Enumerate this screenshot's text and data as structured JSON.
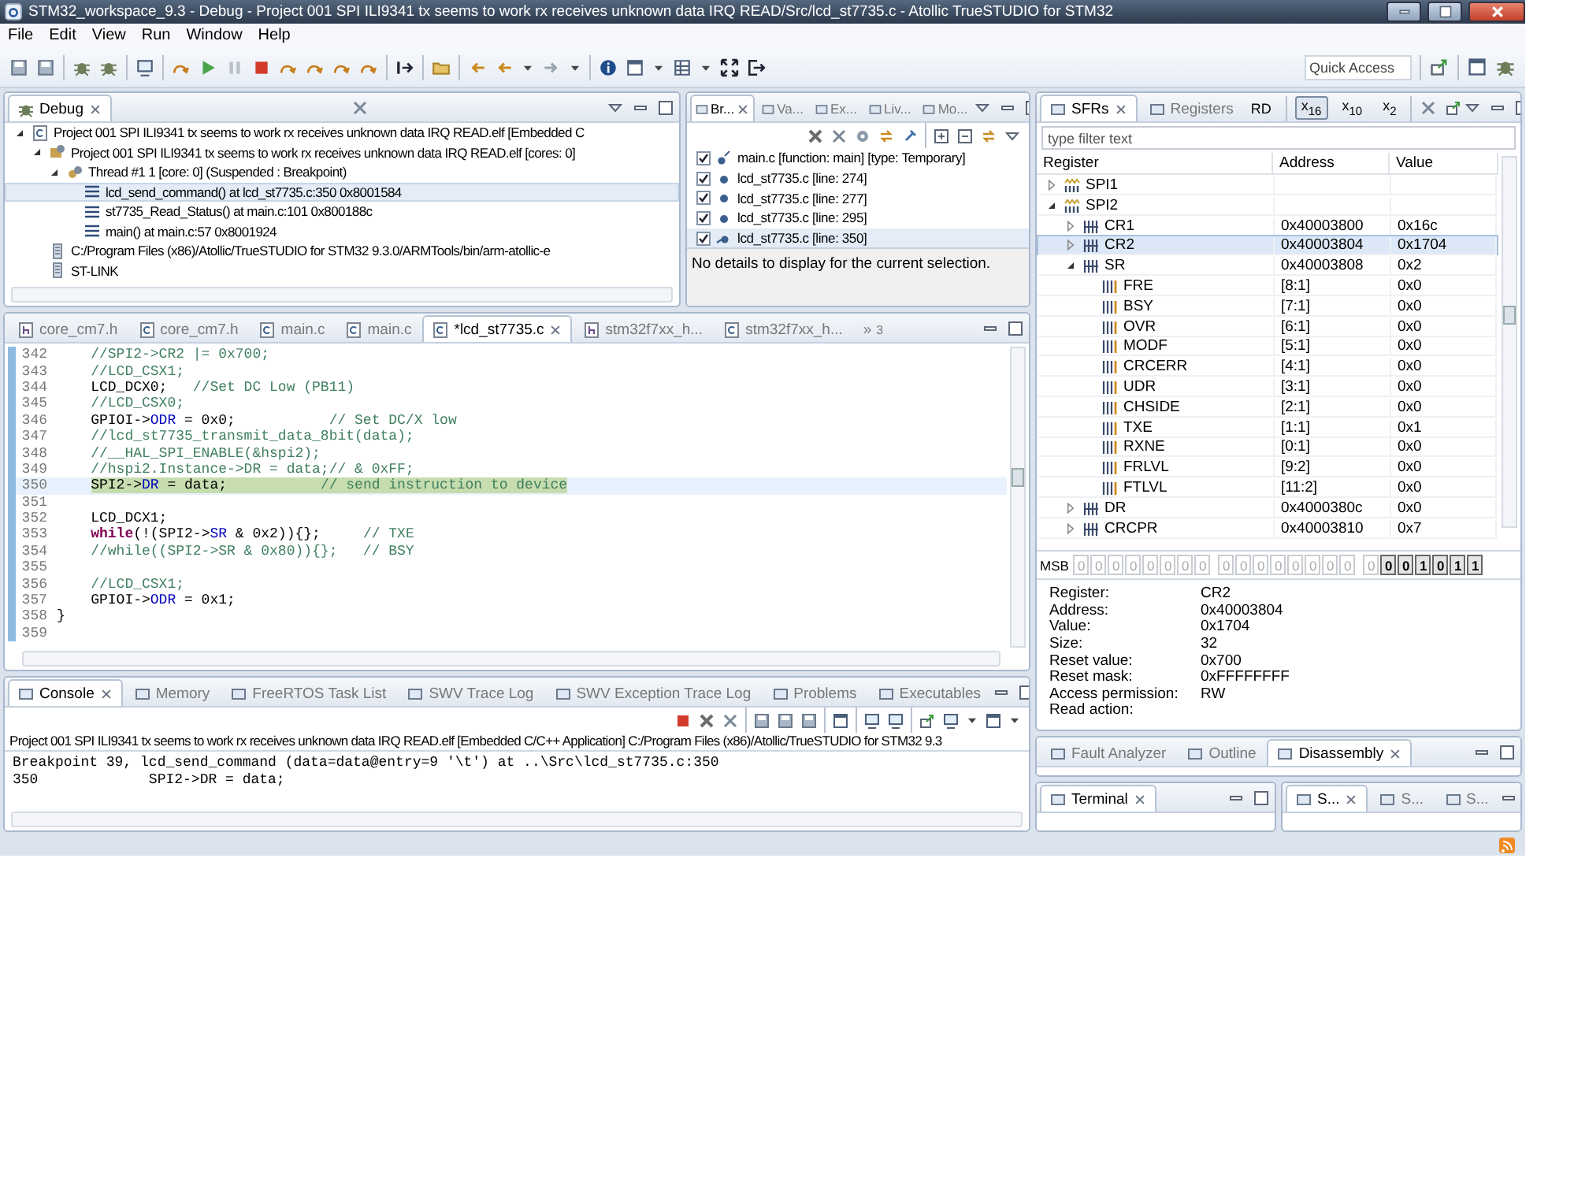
{
  "window": {
    "title": "STM32_workspace_9.3 - Debug - Project 001 SPI ILI9341 tx seems to work rx receives unknown data IRQ READ/Src/lcd_st7735.c - Atollic TrueSTUDIO for STM32"
  },
  "menu": [
    "File",
    "Edit",
    "View",
    "Run",
    "Window",
    "Help"
  ],
  "quick_access": {
    "placeholder": "Quick Access"
  },
  "debug_view": {
    "tab": "Debug",
    "tree": [
      {
        "kind": "launch",
        "label": "Project 001 SPI ILI9341 tx seems to work rx receives unknown data IRQ READ.elf [Embedded C",
        "expanded": true,
        "selected": false,
        "children": [
          {
            "kind": "process",
            "label": "Project 001 SPI ILI9341 tx seems to work rx receives unknown data IRQ READ.elf [cores: 0]",
            "expanded": true,
            "selected": false,
            "children": [
              {
                "kind": "thread",
                "label": "Thread #1 1 [core: 0] (Suspended : Breakpoint)",
                "expanded": true,
                "selected": false,
                "children": [
                  {
                    "kind": "frame",
                    "label": "lcd_send_command() at lcd_st7735.c:350 0x8001584",
                    "selected": true
                  },
                  {
                    "kind": "frame",
                    "label": "st7735_Read_Status() at main.c:101 0x800188c",
                    "selected": false
                  },
                  {
                    "kind": "frame",
                    "label": "main() at main.c:57 0x8001924",
                    "selected": false
                  }
                ]
              }
            ]
          },
          {
            "kind": "binary",
            "label": "C:/Program Files (x86)/Atollic/TrueSTUDIO for STM32 9.3.0/ARMTools/bin/arm-atollic-e",
            "selected": false
          },
          {
            "kind": "binary",
            "label": "ST-LINK",
            "selected": false
          }
        ]
      }
    ]
  },
  "breakpoints_view": {
    "tabs": [
      {
        "label": "Br...",
        "selected": true
      },
      {
        "label": "Va...",
        "selected": false
      },
      {
        "label": "Ex...",
        "selected": false
      },
      {
        "label": "Liv...",
        "selected": false
      },
      {
        "label": "Mo...",
        "selected": false
      }
    ],
    "items": [
      {
        "kind": "temporary",
        "label": "main.c [function: main] [type: Temporary]",
        "checked": true,
        "selected": false
      },
      {
        "kind": "line",
        "label": "lcd_st7735.c [line: 274]",
        "checked": true,
        "selected": false
      },
      {
        "kind": "line",
        "label": "lcd_st7735.c [line: 277]",
        "checked": true,
        "selected": false
      },
      {
        "kind": "line",
        "label": "lcd_st7735.c [line: 295]",
        "checked": true,
        "selected": false
      },
      {
        "kind": "current",
        "label": "lcd_st7735.c [line: 350]",
        "checked": true,
        "selected": true
      }
    ],
    "details": "No details to display for the current selection."
  },
  "editor": {
    "tabs": [
      {
        "kind": "h",
        "label": "core_cm7.h",
        "selected": false
      },
      {
        "kind": "c",
        "label": "core_cm7.h",
        "selected": false
      },
      {
        "kind": "c",
        "label": "main.c",
        "selected": false
      },
      {
        "kind": "c",
        "label": "main.c",
        "selected": false
      },
      {
        "kind": "c",
        "label": "*lcd_st7735.c",
        "selected": true
      },
      {
        "kind": "h",
        "label": "stm32f7xx_h...",
        "selected": false
      },
      {
        "kind": "c",
        "label": "stm32f7xx_h...",
        "selected": false
      }
    ],
    "overflow": "»",
    "overflow_count": "3",
    "lines": [
      {
        "number": "342",
        "current": false,
        "indented": true,
        "segments": [
          {
            "kind": "comment",
            "text": "//SPI2->CR2 |= 0x700;"
          }
        ]
      },
      {
        "number": "343",
        "current": false,
        "indented": true,
        "segments": [
          {
            "kind": "comment",
            "text": "//LCD_CSX1;"
          }
        ]
      },
      {
        "number": "344",
        "current": false,
        "indented": true,
        "segments": [
          {
            "kind": "code",
            "text": "LCD_DCX0;   "
          },
          {
            "kind": "comment",
            "text": "//Set DC Low (PB11)"
          }
        ]
      },
      {
        "number": "345",
        "current": false,
        "indented": true,
        "segments": [
          {
            "kind": "comment",
            "text": "//LCD_CSX0;"
          }
        ]
      },
      {
        "number": "346",
        "current": false,
        "indented": true,
        "segments": [
          {
            "kind": "code",
            "text": "GPIOI->"
          },
          {
            "kind": "field",
            "text": "ODR"
          },
          {
            "kind": "code",
            "text": " = 0x0;           "
          },
          {
            "kind": "comment",
            "text": "// Set DC/X low"
          }
        ]
      },
      {
        "number": "347",
        "current": false,
        "indented": true,
        "segments": [
          {
            "kind": "comment",
            "text": "//lcd_st7735_transmit_data_8bit(data);"
          }
        ]
      },
      {
        "number": "348",
        "current": false,
        "indented": true,
        "segments": [
          {
            "kind": "comment",
            "text": "//__HAL_SPI_ENABLE(&hspi2);"
          }
        ]
      },
      {
        "number": "349",
        "current": false,
        "indented": true,
        "segments": [
          {
            "kind": "comment",
            "text": "//hspi2.Instance->DR = data;// & 0xFF;"
          }
        ]
      },
      {
        "number": "350",
        "current": true,
        "indented": true,
        "segments": [
          {
            "kind": "code",
            "text": "SPI2->"
          },
          {
            "kind": "field",
            "text": "DR"
          },
          {
            "kind": "code",
            "text": " = data;           "
          },
          {
            "kind": "comment",
            "text": "// send instruction to device"
          }
        ]
      },
      {
        "number": "351",
        "current": false
      },
      {
        "number": "352",
        "current": false,
        "indented": true,
        "segments": [
          {
            "kind": "code",
            "text": "LCD_DCX1;"
          }
        ]
      },
      {
        "number": "353",
        "current": false,
        "indented": true,
        "segments": [
          {
            "kind": "keyword",
            "text": "while"
          },
          {
            "kind": "code",
            "text": "(!(SPI2->"
          },
          {
            "kind": "field",
            "text": "SR"
          },
          {
            "kind": "code",
            "text": " & 0x2)){};     "
          },
          {
            "kind": "comment",
            "text": "// TXE"
          }
        ]
      },
      {
        "number": "354",
        "current": false,
        "indented": true,
        "segments": [
          {
            "kind": "comment",
            "text": "//while((SPI2->SR & 0x80)){};   // BSY"
          }
        ]
      },
      {
        "number": "355",
        "current": false
      },
      {
        "number": "356",
        "current": false,
        "indented": true,
        "segments": [
          {
            "kind": "comment",
            "text": "//LCD_CSX1;"
          }
        ]
      },
      {
        "number": "357",
        "current": false,
        "indented": true,
        "segments": [
          {
            "kind": "code",
            "text": "GPIOI->"
          },
          {
            "kind": "field",
            "text": "ODR"
          },
          {
            "kind": "code",
            "text": " = 0x1;"
          }
        ]
      },
      {
        "number": "358",
        "current": false,
        "indented": false,
        "segments": [
          {
            "kind": "code",
            "text": "}"
          }
        ]
      },
      {
        "number": "359",
        "current": false
      }
    ]
  },
  "console": {
    "tabs": [
      {
        "label": "Console",
        "selected": true
      },
      {
        "label": "Memory",
        "selected": false
      },
      {
        "label": "FreeRTOS Task List",
        "selected": false
      },
      {
        "label": "SWV Trace Log",
        "selected": false
      },
      {
        "label": "SWV Exception Trace Log",
        "selected": false
      },
      {
        "label": "Problems",
        "selected": false
      },
      {
        "label": "Executables",
        "selected": false
      }
    ],
    "header": "Project 001 SPI ILI9341 tx seems to work rx receives unknown data IRQ READ.elf [Embedded C/C++ Application] C:/Program Files (x86)/Atollic/TrueSTUDIO for STM32 9.3",
    "lines": [
      "Breakpoint 39, lcd_send_command (data=data@entry=9 '\\t') at ..\\Src\\lcd_st7735.c:350",
      "350             SPI2->DR = data;"
    ]
  },
  "sfr": {
    "tabs": [
      {
        "label": "SFRs",
        "selected": true
      },
      {
        "label": "Registers",
        "selected": false
      }
    ],
    "read_button": "RD",
    "radix": [
      {
        "label": "x$_{16}$",
        "selected": true
      },
      {
        "label": "x$_{10}$",
        "selected": false
      },
      {
        "label": "x$_{2}$",
        "selected": false
      }
    ],
    "filter": {
      "placeholder": "type filter text"
    },
    "columns": [
      "Register",
      "Address",
      "Value"
    ],
    "rows": [
      {
        "kind": "peripheral",
        "name": "SPI1",
        "expanded": false,
        "selected": false
      },
      {
        "kind": "peripheral",
        "name": "SPI2",
        "expanded": true,
        "selected": false,
        "children": [
          {
            "kind": "register",
            "name": "CR1",
            "address": "0x40003800",
            "value": "0x16c",
            "expanded": false,
            "selected": false
          },
          {
            "kind": "register",
            "name": "CR2",
            "address": "0x40003804",
            "value": "0x1704",
            "expanded": false,
            "selected": true
          },
          {
            "kind": "register",
            "name": "SR",
            "address": "0x40003808",
            "value": "0x2",
            "expanded": true,
            "selected": false,
            "children": [
              {
                "kind": "field",
                "name": "FRE",
                "address": "[8:1]",
                "value": "0x0",
                "selected": false
              },
              {
                "kind": "field",
                "name": "BSY",
                "address": "[7:1]",
                "value": "0x0",
                "selected": false
              },
              {
                "kind": "field",
                "name": "OVR",
                "address": "[6:1]",
                "value": "0x0",
                "selected": false
              },
              {
                "kind": "field",
                "name": "MODF",
                "address": "[5:1]",
                "value": "0x0",
                "selected": false
              },
              {
                "kind": "field",
                "name": "CRCERR",
                "address": "[4:1]",
                "value": "0x0",
                "selected": false
              },
              {
                "kind": "field",
                "name": "UDR",
                "address": "[3:1]",
                "value": "0x0",
                "selected": false
              },
              {
                "kind": "field",
                "name": "CHSIDE",
                "address": "[2:1]",
                "value": "0x0",
                "selected": false
              },
              {
                "kind": "field",
                "name": "TXE",
                "address": "[1:1]",
                "value": "0x1",
                "selected": false
              },
              {
                "kind": "field",
                "name": "RXNE",
                "address": "[0:1]",
                "value": "0x0",
                "selected": false
              },
              {
                "kind": "field",
                "name": "FRLVL",
                "address": "[9:2]",
                "value": "0x0",
                "selected": false
              },
              {
                "kind": "field",
                "name": "FTLVL",
                "address": "[11:2]",
                "value": "0x0",
                "selected": false
              }
            ]
          },
          {
            "kind": "register",
            "name": "DR",
            "address": "0x4000380c",
            "value": "0x0",
            "expanded": false,
            "selected": false
          },
          {
            "kind": "register",
            "name": "CRCPR",
            "address": "0x40003810",
            "value": "0x7",
            "expanded": false,
            "selected": false
          }
        ]
      }
    ],
    "bits_label": "MSB",
    "bits": [
      {
        "text": "0",
        "active": false
      },
      {
        "text": "0",
        "active": false
      },
      {
        "text": "0",
        "active": false
      },
      {
        "text": "0",
        "active": false
      },
      {
        "text": "0",
        "active": false
      },
      {
        "text": "0",
        "active": false
      },
      {
        "text": "0",
        "active": false
      },
      {
        "text": "0",
        "active": false
      },
      {
        "text": "0",
        "active": false
      },
      {
        "text": "0",
        "active": false
      },
      {
        "text": "0",
        "active": false
      },
      {
        "text": "0",
        "active": false
      },
      {
        "text": "0",
        "active": false
      },
      {
        "text": "0",
        "active": false
      },
      {
        "text": "0",
        "active": false
      },
      {
        "text": "0",
        "active": false
      },
      {
        "text": "0",
        "active": false
      },
      {
        "text": "0",
        "active": true
      },
      {
        "text": "0",
        "active": true
      },
      {
        "text": "1",
        "active": true
      },
      {
        "text": "0",
        "active": true
      },
      {
        "text": "1",
        "active": true
      },
      {
        "text": "1",
        "active": true
      }
    ],
    "details": [
      {
        "label": "Register:",
        "value": "CR2"
      },
      {
        "label": "Address:",
        "value": "0x40003804"
      },
      {
        "label": "Value:",
        "value": "0x1704"
      },
      {
        "label": "Size:",
        "value": "32"
      },
      {
        "label": "Reset value:",
        "value": "0x700"
      },
      {
        "label": "Reset mask:",
        "value": "0xFFFFFFFF"
      },
      {
        "label": "Access permission:",
        "value": "RW"
      },
      {
        "label": "Read action:"
      }
    ]
  },
  "disassembly_view": {
    "tabs": [
      {
        "label": "Fault Analyzer",
        "selected": false
      },
      {
        "label": "Outline",
        "selected": false
      },
      {
        "label": "Disassembly",
        "selected": true
      }
    ]
  },
  "bottom_views": [
    {
      "tabs": [
        {
          "label": "Terminal",
          "selected": true
        }
      ]
    },
    {
      "tabs": [
        {
          "label": "S...",
          "selected": true
        },
        {
          "label": "S...",
          "selected": false
        },
        {
          "label": "S...",
          "selected": false
        }
      ]
    }
  ]
}
